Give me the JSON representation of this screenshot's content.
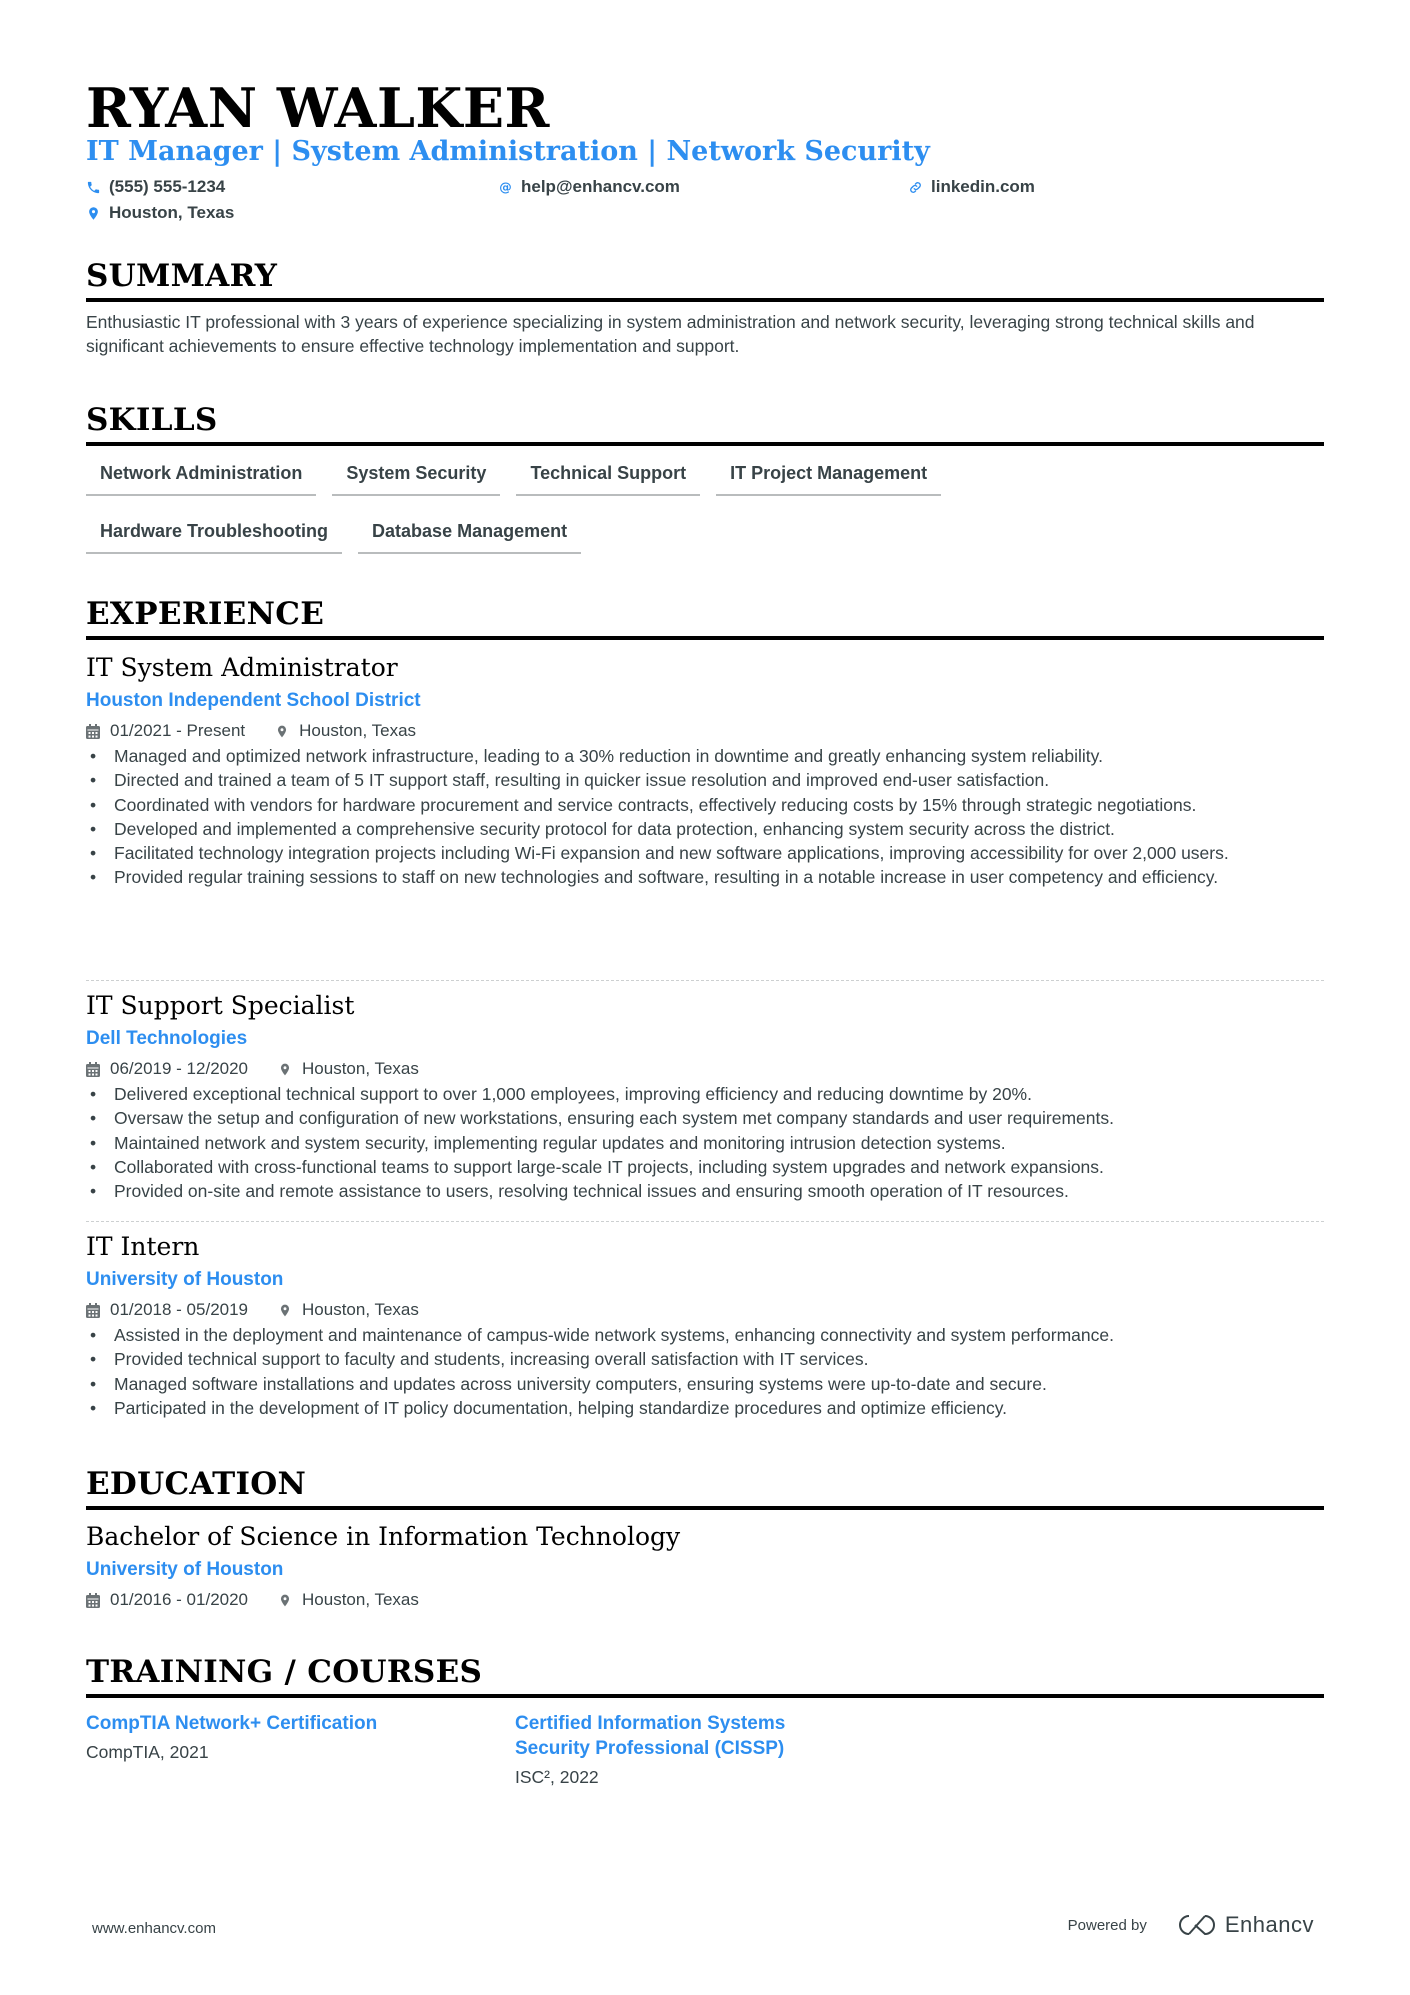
{
  "header": {
    "name": "RYAN WALKER",
    "headline": "IT Manager | System Administration | Network Security",
    "contact": {
      "phone": "(555) 555-1234",
      "email": "help@enhancv.com",
      "link": "linkedin.com",
      "location": "Houston, Texas"
    }
  },
  "summary": {
    "title": "SUMMARY",
    "text": "Enthusiastic IT professional with 3 years of experience specializing in system administration and network security, leveraging strong technical skills and significant achievements to ensure effective technology implementation and support."
  },
  "skills": {
    "title": "SKILLS",
    "items": [
      "Network Administration",
      "System Security",
      "Technical Support",
      "IT Project Management",
      "Hardware Troubleshooting",
      "Database Management"
    ]
  },
  "experience": {
    "title": "EXPERIENCE",
    "jobs": [
      {
        "title": "IT System Administrator",
        "company": "Houston Independent School District",
        "dates": "01/2021 - Present",
        "location": "Houston, Texas",
        "bullets": [
          "Managed and optimized network infrastructure, leading to a 30% reduction in downtime and greatly enhancing system reliability.",
          "Directed and trained a team of 5 IT support staff, resulting in quicker issue resolution and improved end-user satisfaction.",
          "Coordinated with vendors for hardware procurement and service contracts, effectively reducing costs by 15% through strategic negotiations.",
          "Developed and implemented a comprehensive security protocol for data protection, enhancing system security across the district.",
          "Facilitated technology integration projects including Wi-Fi expansion and new software applications, improving accessibility for over 2,000 users.",
          "Provided regular training sessions to staff on new technologies and software, resulting in a notable increase in user competency and efficiency."
        ]
      },
      {
        "title": "IT Support Specialist",
        "company": "Dell Technologies",
        "dates": "06/2019 - 12/2020",
        "location": "Houston, Texas",
        "bullets": [
          "Delivered exceptional technical support to over 1,000 employees, improving efficiency and reducing downtime by 20%.",
          "Oversaw the setup and configuration of new workstations, ensuring each system met company standards and user requirements.",
          "Maintained network and system security, implementing regular updates and monitoring intrusion detection systems.",
          "Collaborated with cross-functional teams to support large-scale IT projects, including system upgrades and network expansions.",
          "Provided on-site and remote assistance to users, resolving technical issues and ensuring smooth operation of IT resources."
        ]
      },
      {
        "title": "IT Intern",
        "company": "University of Houston",
        "dates": "01/2018 - 05/2019",
        "location": "Houston, Texas",
        "bullets": [
          "Assisted in the deployment and maintenance of campus-wide network systems, enhancing connectivity and system performance.",
          "Provided technical support to faculty and students, increasing overall satisfaction with IT services.",
          "Managed software installations and updates across university computers, ensuring systems were up-to-date and secure.",
          "Participated in the development of IT policy documentation, helping standardize procedures and optimize efficiency."
        ]
      }
    ]
  },
  "education": {
    "title": "EDUCATION",
    "degree": "Bachelor of Science in Information Technology",
    "school": "University of Houston",
    "dates": "01/2016 - 01/2020",
    "location": "Houston, Texas"
  },
  "training": {
    "title": "TRAINING / COURSES",
    "items": [
      {
        "title": "CompTIA Network+ Certification",
        "subtitle": "CompTIA, 2021"
      },
      {
        "title": "Certified Information Systems Security Professional (CISSP)",
        "subtitle": "ISC², 2022"
      }
    ]
  },
  "footer": {
    "website": "www.enhancv.com",
    "powered_by": "Powered by",
    "brand": "Enhancv"
  },
  "colors": {
    "accent": "#2d8ef0",
    "text": "#384347",
    "heading": "#000000"
  }
}
